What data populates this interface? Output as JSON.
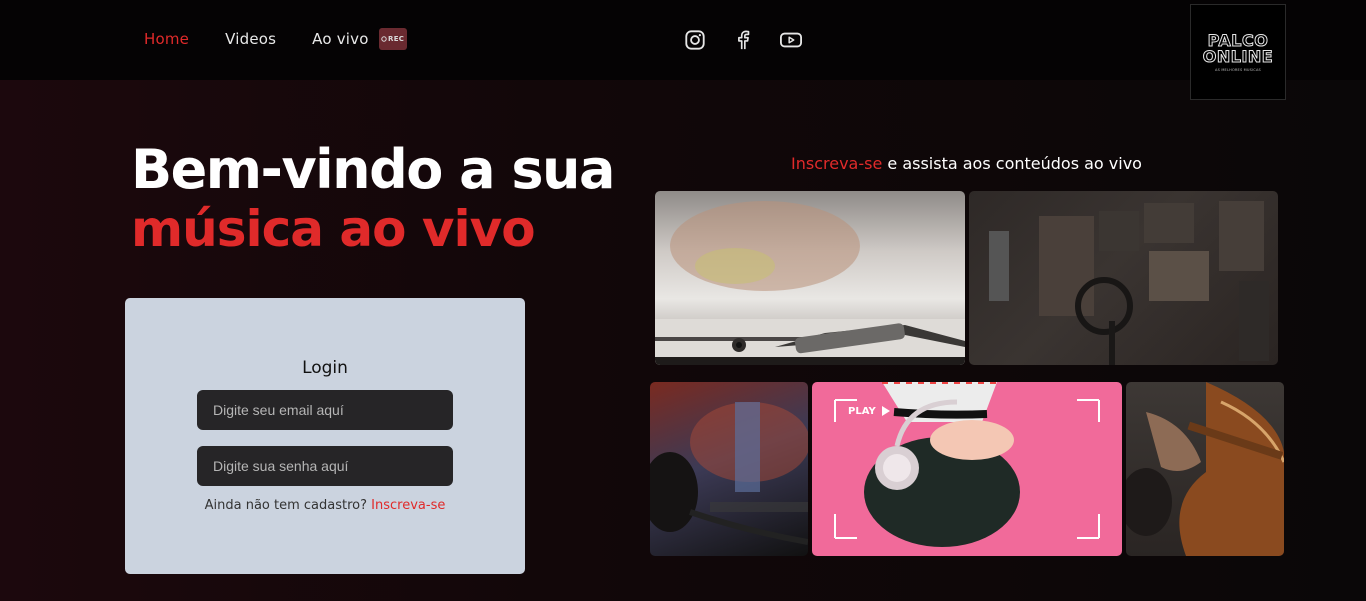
{
  "nav": {
    "home": "Home",
    "videos": "Videos",
    "live": "Ao vivo",
    "live_badge": "REC"
  },
  "socials": [
    "instagram-icon",
    "facebook-icon",
    "youtube-icon"
  ],
  "logo": {
    "line1": "PALCO",
    "line2": "ONLINE",
    "tagline": "AS MELHORES MUSICAS"
  },
  "hero": {
    "line1": "Bem-vindo a sua",
    "line2": "música ao vivo"
  },
  "login": {
    "title": "Login",
    "email_placeholder": "Digite seu email aquí",
    "password_placeholder": "Digite sua senha aquí",
    "no_account_text": "Ainda não tem cadastro?",
    "signup_link": "Inscreva-se"
  },
  "promo": {
    "accent": "Inscreva-se",
    "rest": " e assista aos conteúdos ao vivo"
  },
  "gallery": {
    "play_label": "PLAY"
  },
  "colors": {
    "accent": "#e02a2a",
    "card_bg": "#cbd3df",
    "input_bg": "#262527",
    "header_bg": "#050304"
  }
}
